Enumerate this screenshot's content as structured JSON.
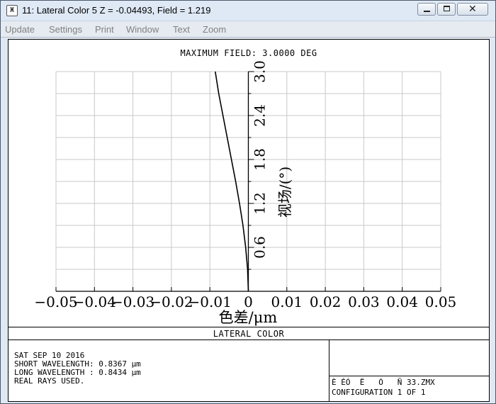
{
  "window": {
    "title": "11: Lateral Color 5 Z = -0.04493, Field = 1.219",
    "icon": "zemax-app-icon",
    "controls": {
      "minimize": "minimize-icon",
      "maximize": "maximize-icon",
      "close": "close-icon"
    }
  },
  "menu": [
    "Update",
    "Settings",
    "Print",
    "Window",
    "Text",
    "Zoom"
  ],
  "plot": {
    "title": "MAXIMUM FIELD: 3.0000 DEG",
    "footer_title": "LATERAL COLOR",
    "info_lines": [
      "SAT SEP 10 2016",
      "SHORT WAVELENGTH: 0.8367 µm",
      "LONG WAVELENGTH : 0.8434 µm",
      "REAL RAYS USED."
    ],
    "config_lines": [
      "È ÉÓ  Ë   Ó   Ñ 33.ZMX",
      "CONFIGURATION 1 OF 1"
    ]
  },
  "chart_data": {
    "type": "line",
    "xlabel": "色差/μm",
    "ylabel": "视场/(°)",
    "xlim": [
      -0.05,
      0.05
    ],
    "ylim": [
      0,
      3.0
    ],
    "x_ticks": [
      "−0.05",
      "−0.04",
      "−0.03",
      "−0.02",
      "−0.01",
      "0",
      "0.01",
      "0.02",
      "0.03",
      "0.04",
      "0.05"
    ],
    "y_ticks": [
      "0.6",
      "1.2",
      "1.8",
      "2.4",
      "3.0"
    ],
    "grid": true,
    "series": [
      {
        "color": "#000000",
        "x": [
          0,
          -0.0002,
          -0.0007,
          -0.0014,
          -0.0023,
          -0.0033,
          -0.0044,
          -0.0055,
          -0.0066,
          -0.0077,
          -0.0086
        ],
        "y": [
          0,
          0.3,
          0.6,
          0.9,
          1.2,
          1.5,
          1.8,
          2.1,
          2.4,
          2.7,
          3.0
        ]
      }
    ]
  }
}
